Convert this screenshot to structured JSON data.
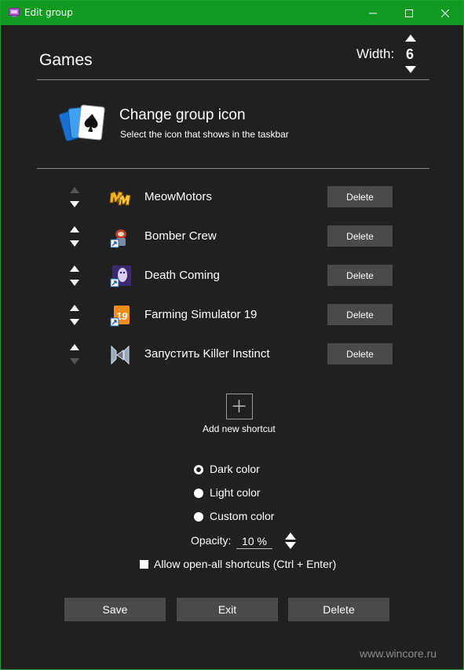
{
  "window": {
    "title": "Edit group",
    "accent_color": "#0f9b1f",
    "icons": {
      "app": "app-window-icon",
      "minimize": "minimize-icon",
      "maximize": "maximize-icon",
      "close": "close-icon"
    }
  },
  "header": {
    "group_name": "Games",
    "width_label": "Width:",
    "width_value": "6"
  },
  "group_icon": {
    "icon": "cards-spade-icon",
    "title": "Change group icon",
    "subtitle": "Select the icon that shows in the taskbar"
  },
  "shortcuts": [
    {
      "name": "MeowMotors",
      "icon": "meowmotors-game-icon",
      "delete_label": "Delete",
      "up_enabled": false,
      "down_enabled": true
    },
    {
      "name": "Bomber Crew",
      "icon": "bomber-crew-game-icon",
      "delete_label": "Delete",
      "up_enabled": true,
      "down_enabled": true
    },
    {
      "name": "Death Coming",
      "icon": "death-coming-game-icon",
      "delete_label": "Delete",
      "up_enabled": true,
      "down_enabled": true
    },
    {
      "name": "Farming Simulator 19",
      "icon": "farming-simulator-19-game-icon",
      "delete_label": "Delete",
      "up_enabled": true,
      "down_enabled": true
    },
    {
      "name": "Запустить Killer Instinct",
      "icon": "killer-instinct-game-icon",
      "delete_label": "Delete",
      "up_enabled": true,
      "down_enabled": false
    }
  ],
  "add_shortcut": {
    "label": "Add new shortcut",
    "icon": "plus-icon"
  },
  "color_options": [
    {
      "label": "Dark color",
      "selected": true
    },
    {
      "label": "Light color",
      "selected": false
    },
    {
      "label": "Custom color",
      "selected": false
    }
  ],
  "opacity": {
    "label": "Opacity:",
    "value": "10 %"
  },
  "open_all": {
    "label": "Allow open-all shortcuts (Ctrl + Enter)",
    "checked": false
  },
  "buttons": {
    "save": "Save",
    "exit": "Exit",
    "delete": "Delete"
  },
  "watermark": "www.wincore.ru"
}
